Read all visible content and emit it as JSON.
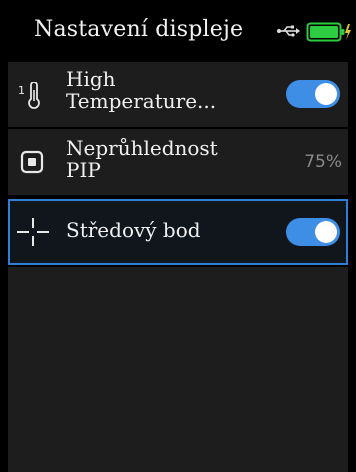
{
  "header": {
    "title": "Nastavení displeje",
    "usb_icon": "usb-icon",
    "battery_icon": "battery-charging-icon",
    "battery_color": "#2ecc40"
  },
  "settings": [
    {
      "label_line1": "High",
      "label_line2": "Temperature...",
      "icon": "thermometer-icon",
      "control": "toggle",
      "on": true
    },
    {
      "label_line1": "Neprůhlednost",
      "label_line2": "PIP",
      "icon": "pip-icon",
      "control": "value",
      "value": "75%"
    },
    {
      "label": "Středový bod",
      "icon": "crosshair-icon",
      "control": "toggle",
      "on": true,
      "selected": true
    }
  ],
  "colors": {
    "accent": "#3e8ee6",
    "selection_border": "#2f7fd6",
    "row_bg": "#1d1d1d"
  }
}
